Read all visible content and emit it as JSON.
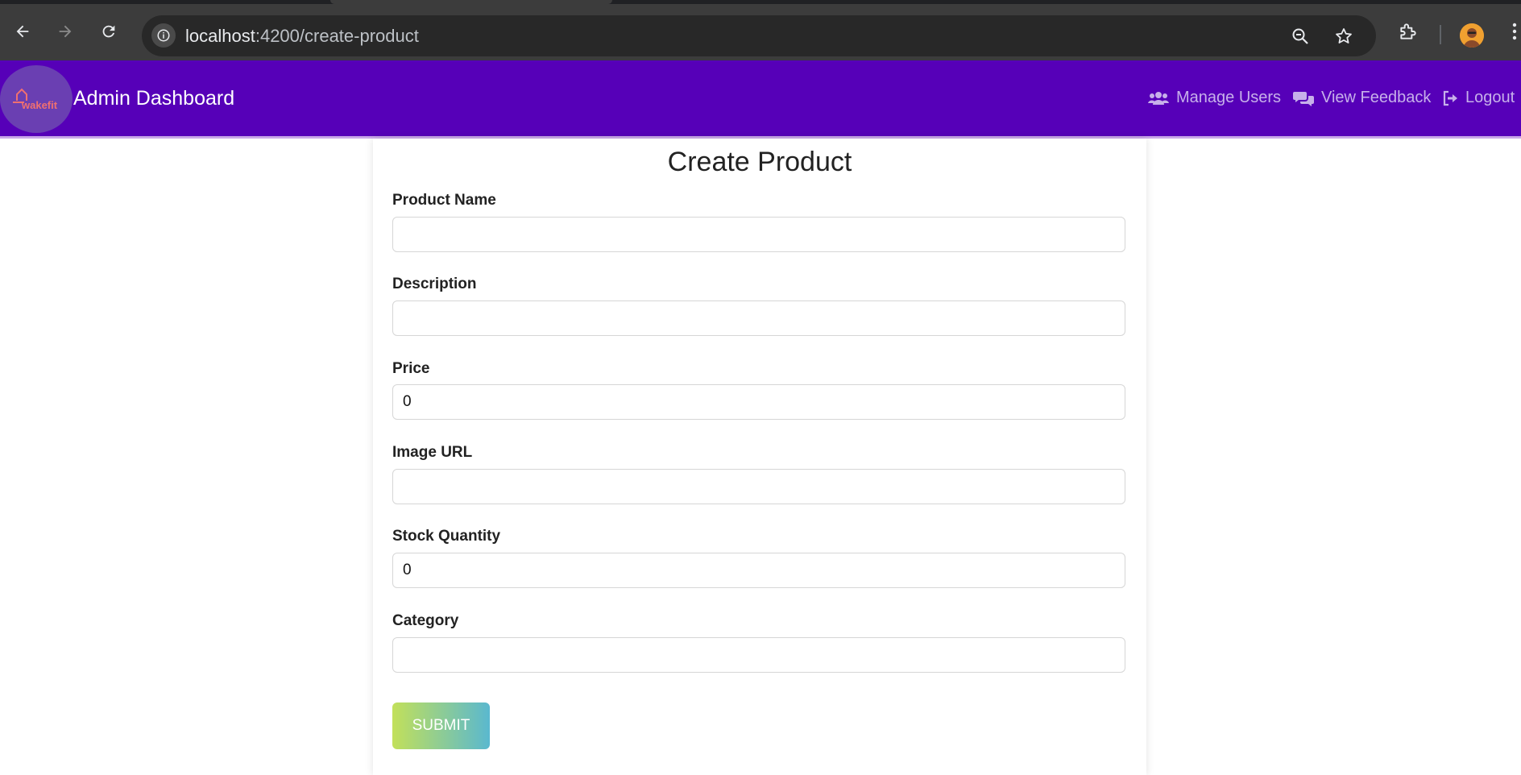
{
  "browser": {
    "url_host": "localhost",
    "url_rest": ":4200/create-product",
    "icons": {
      "back": "back-arrow-icon",
      "forward": "forward-arrow-icon",
      "reload": "reload-icon",
      "info": "info-icon",
      "zoom": "zoom-icon",
      "bookmark": "star-icon",
      "extensions": "puzzle-icon",
      "menu": "kebab-menu-icon"
    }
  },
  "navbar": {
    "logo_text": "wakefit",
    "title": "Admin Dashboard",
    "links": [
      {
        "label": "Manage Users",
        "icon": "users-icon"
      },
      {
        "label": "View Feedback",
        "icon": "comments-icon"
      },
      {
        "label": "Logout",
        "icon": "logout-icon"
      }
    ],
    "colors": {
      "background": "#5600b8",
      "link": "#c7b0ea"
    }
  },
  "form": {
    "title": "Create Product",
    "fields": [
      {
        "label": "Product Name",
        "value": ""
      },
      {
        "label": "Description",
        "value": ""
      },
      {
        "label": "Price",
        "value": "0"
      },
      {
        "label": "Image URL",
        "value": ""
      },
      {
        "label": "Stock Quantity",
        "value": "0"
      },
      {
        "label": "Category",
        "value": ""
      }
    ],
    "submit_label": "SUBMIT"
  }
}
